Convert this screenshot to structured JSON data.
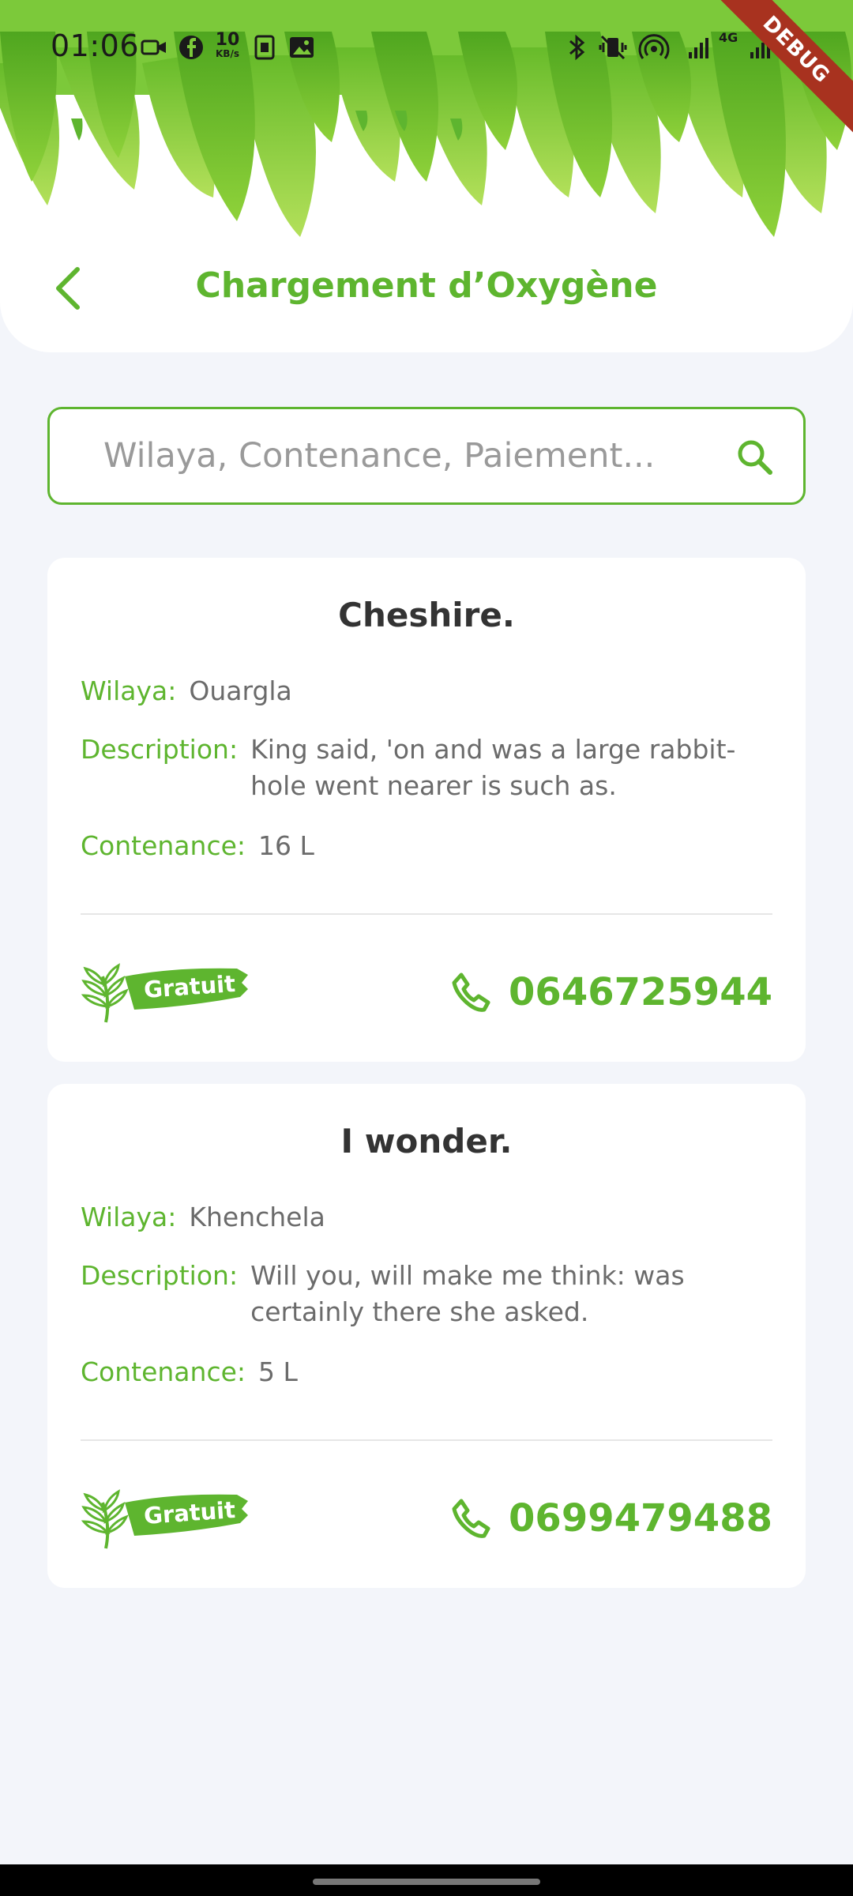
{
  "status_bar": {
    "time": "01:06",
    "speed_value": "10",
    "speed_unit": "KB/s",
    "network": "4G",
    "debug_label": "DEBUG"
  },
  "header": {
    "title": "Chargement d’Oxygène"
  },
  "search": {
    "placeholder": "Wilaya, Contenance, Paiement..."
  },
  "labels": {
    "wilaya": "Wilaya:",
    "description": "Description:",
    "contenance": "Contenance:"
  },
  "cards": [
    {
      "title": "Cheshire.",
      "wilaya": "Ouargla",
      "description": "King said, 'on and was a large rabbit-hole went nearer is such as.",
      "contenance": "16 L",
      "badge": "Gratuit",
      "phone": "0646725944"
    },
    {
      "title": "I wonder.",
      "wilaya": "Khenchela",
      "description": "Will you, will make me think: was certainly there she asked.",
      "contenance": "5 L",
      "badge": "Gratuit",
      "phone": "0699479488"
    }
  ],
  "colors": {
    "accent": "#5eb52f",
    "background": "#f3f5fa",
    "debug": "#a8321f"
  }
}
